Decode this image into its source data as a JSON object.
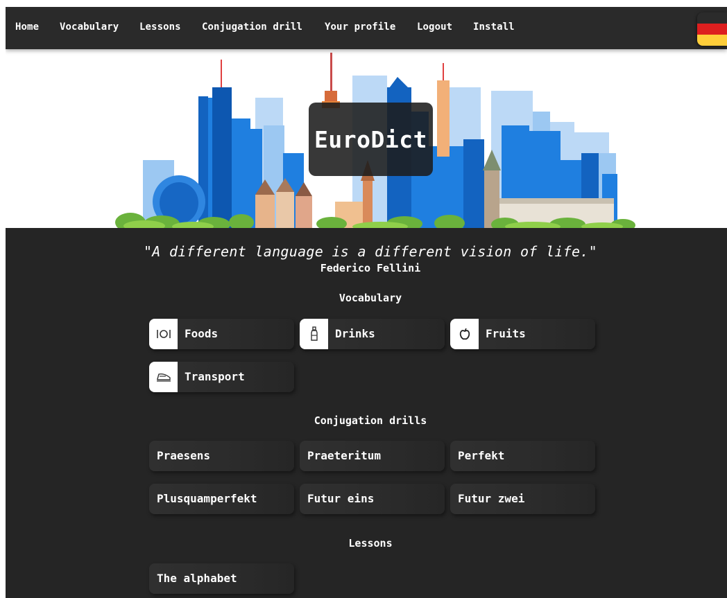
{
  "nav": {
    "items": [
      {
        "label": "Home"
      },
      {
        "label": "Vocabulary"
      },
      {
        "label": "Lessons"
      },
      {
        "label": "Conjugation drill"
      },
      {
        "label": "Your profile"
      },
      {
        "label": "Logout"
      },
      {
        "label": "Install"
      }
    ],
    "flag_colors": [
      "#2b2b2b",
      "#dd1f1f",
      "#ffce3a"
    ]
  },
  "hero": {
    "title": "EuroDict"
  },
  "quote": {
    "text": "\"A different language is a different vision of life.\"",
    "author": "Federico Fellini"
  },
  "vocabulary": {
    "title": "Vocabulary",
    "items": [
      {
        "label": "Foods",
        "icon": "cutlery-icon"
      },
      {
        "label": "Drinks",
        "icon": "bottle-icon"
      },
      {
        "label": "Fruits",
        "icon": "apple-icon"
      },
      {
        "label": "Transport",
        "icon": "train-icon"
      }
    ]
  },
  "conjugation": {
    "title": "Conjugation drills",
    "items": [
      {
        "label": "Praesens"
      },
      {
        "label": "Praeteritum"
      },
      {
        "label": "Perfekt"
      },
      {
        "label": "Plusquamperfekt"
      },
      {
        "label": "Futur eins"
      },
      {
        "label": "Futur zwei"
      }
    ]
  },
  "lessons": {
    "title": "Lessons",
    "items": [
      {
        "label": "The alphabet"
      }
    ]
  }
}
